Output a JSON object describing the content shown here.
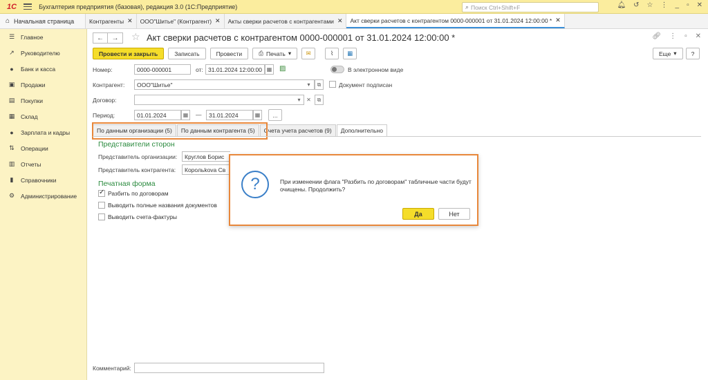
{
  "titlebar": {
    "logo": "1С",
    "app_title": "Бухгалтерия предприятия (базовая), редакция 3.0  (1С:Предприятие)",
    "search_placeholder": "Поиск Ctrl+Shift+F"
  },
  "tabs": {
    "home": "Начальная страница",
    "items": [
      {
        "label": "Контрагенты"
      },
      {
        "label": "ООО\"Шитье\" (Контрагент)"
      },
      {
        "label": "Акты сверки расчетов с контрагентами"
      },
      {
        "label": "Акт сверки расчетов с контрагентом 0000-000001 от 31.01.2024 12:00:00 *"
      }
    ]
  },
  "sidebar": {
    "items": [
      {
        "label": "Главное",
        "icon": "menu-icon"
      },
      {
        "label": "Руководителю",
        "icon": "chart-line-icon"
      },
      {
        "label": "Банк и касса",
        "icon": "bank-icon"
      },
      {
        "label": "Продажи",
        "icon": "bag-icon"
      },
      {
        "label": "Покупки",
        "icon": "cart-icon"
      },
      {
        "label": "Склад",
        "icon": "warehouse-icon"
      },
      {
        "label": "Зарплата и кадры",
        "icon": "person-icon"
      },
      {
        "label": "Операции",
        "icon": "operations-icon"
      },
      {
        "label": "Отчеты",
        "icon": "report-icon"
      },
      {
        "label": "Справочники",
        "icon": "book-icon"
      },
      {
        "label": "Администрирование",
        "icon": "gear-icon"
      }
    ]
  },
  "form": {
    "title": "Акт сверки расчетов с контрагентом 0000-000001 от 31.01.2024 12:00:00 *",
    "toolbar": {
      "post_close": "Провести и закрыть",
      "save": "Записать",
      "post": "Провести",
      "print": "Печать",
      "more": "Еще",
      "help": "?"
    },
    "fields": {
      "number_label": "Номер:",
      "number_value": "0000-000001",
      "date_label": "от:",
      "date_value": "31.01.2024 12:00:00",
      "electronic_label": "В электронном виде",
      "counterparty_label": "Контрагент:",
      "counterparty_value": "ООО\"Шитье\"",
      "signed_label": "Документ подписан",
      "contract_label": "Договор:",
      "contract_value": "",
      "period_label": "Период:",
      "period_from": "01.01.2024",
      "period_dash": "—",
      "period_to": "31.01.2024",
      "period_more": "..."
    },
    "tabs": [
      {
        "label": "По данным организации (5)"
      },
      {
        "label": "По данным контрагента (5)"
      },
      {
        "label": "Счета учета расчетов (9)"
      },
      {
        "label": "Дополнительно"
      }
    ],
    "additional": {
      "reps_title": "Представители сторон",
      "org_rep_label": "Представитель организации:",
      "org_rep_value": "Круглов Борис",
      "cp_rep_label": "Представитель контрагента:",
      "cp_rep_value": "Корольkova Св",
      "print_title": "Печатная форма",
      "cb_split": "Разбить по договорам",
      "cb_fullnames": "Выводить полные названия документов",
      "cb_invoices": "Выводить счета-фактуры"
    },
    "comment_label": "Комментарий:"
  },
  "dialog": {
    "message": "При изменении флага \"Разбить по договорам\" табличные части будут очищены. Продолжить?",
    "yes": "Да",
    "no": "Нет"
  }
}
